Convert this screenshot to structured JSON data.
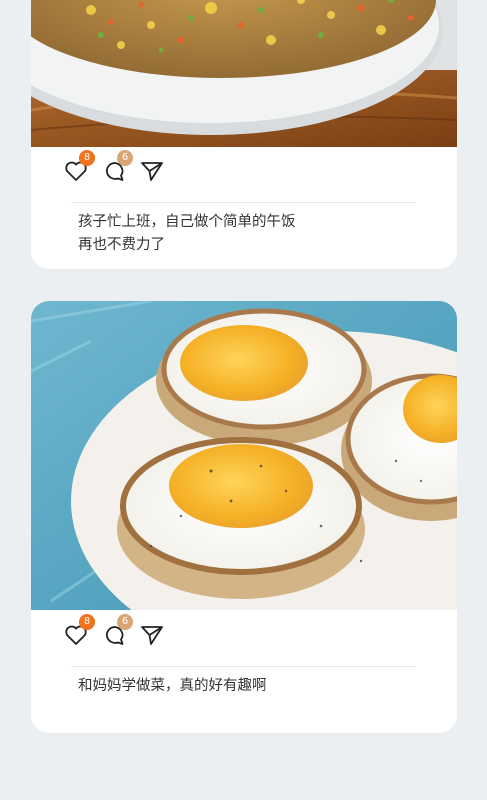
{
  "posts": [
    {
      "image_label": "fried-rice-photo",
      "likes": "8",
      "comments": "6",
      "caption_lines": [
        "孩子忙上班，自己做个简单的午饭",
        "再也不费力了"
      ]
    },
    {
      "image_label": "fried-egg-onion-rings-photo",
      "likes": "8",
      "comments": "6",
      "caption_lines": [
        "和妈妈学做菜，真的好有趣啊"
      ]
    }
  ],
  "colors": {
    "background": "#eceff1",
    "card": "#ffffff",
    "like_badge": "#f2711c",
    "comment_badge": "#d9a574",
    "icon_stroke": "#222222"
  }
}
